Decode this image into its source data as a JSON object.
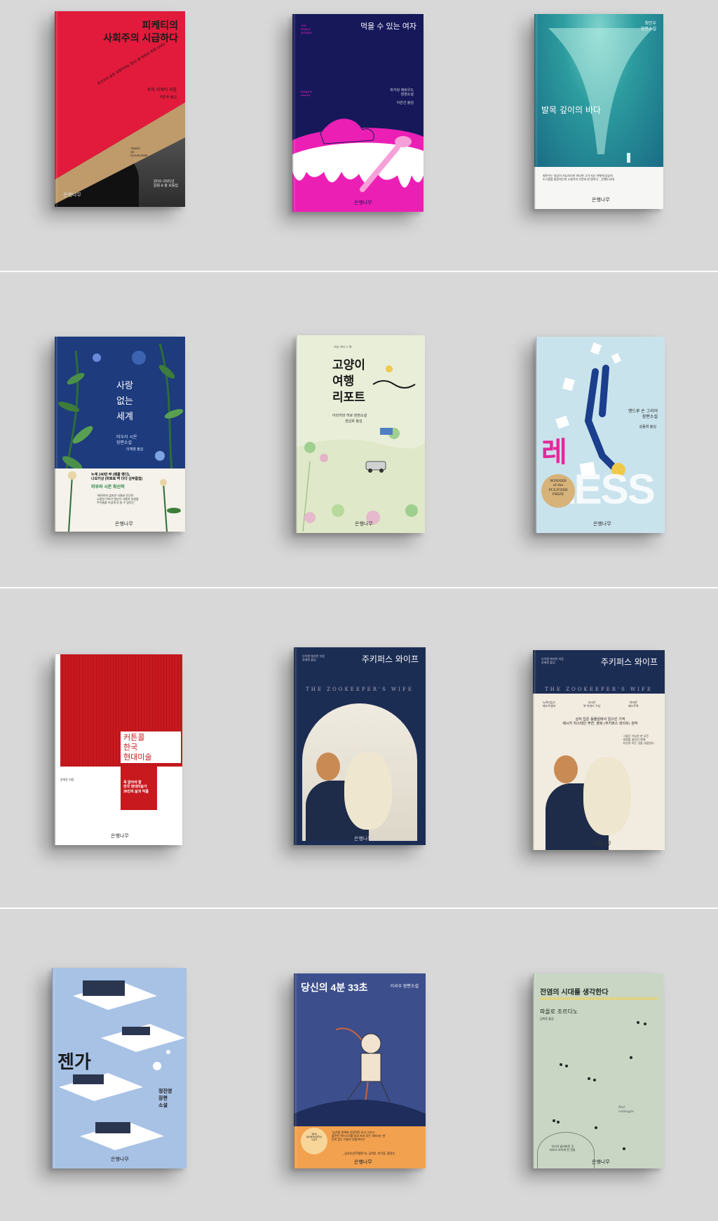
{
  "books": [
    {
      "title": "피케티의\n사회주의 시급하다",
      "tagline": "공산주의 같은 치명적이는 한다! 총 부자의 독재 시대다",
      "author": "토마 피케티 지음",
      "translator": "이민주 옮김",
      "english_title": "TEMPS\nDE\nSOCIALISME",
      "year_note": "2016~2021년\n칼럼 & 총 모음집",
      "publisher": "은행나무",
      "colors": {
        "top": "#e21b3c",
        "band": "#bf9a6a",
        "text": "#1a1a1a"
      }
    },
    {
      "title": "먹을 수 있는 여자",
      "english_title": "THE\nEDIBLE\nWOMAN",
      "english_author": "Margaret\nAtwood",
      "author": "마거릿 애트우드\n장편소설",
      "translator": "이은선 옮김",
      "publisher": "은행나무",
      "colors": {
        "bg": "#16185a",
        "accent": "#ec1fb5"
      }
    },
    {
      "author": "최민우\n장편소설",
      "title": "발목 깊이의 바다",
      "blurb": "최민우는 일상이 가능하기만 하다면 그가 지닌 어떻게 상상의\n도시풍을 발랑하는데 소설가의 가운데 한 명이다. _은행도서대",
      "publisher": "은행나무",
      "colors": {
        "sea": "#2c9c9f",
        "deep": "#1a6c85"
      }
    },
    {
      "title": "사랑\n없는\n세계",
      "author": "미우라 시온\n장편소설",
      "translator": "이재영 옮김",
      "headline": "누계 140만 부 (배를 엮다),\n나오키상 (마호로 역 다다 심부름집)",
      "highlight": "미우라 시온 최신작",
      "quote": "\"화려하지 않지만 식물과 인간이\n소중한 이야기 빛난다 식물의 일생을\n주어들을 뜨겁게 뒤 일 수 있다는\"",
      "publisher": "은행나무",
      "colors": {
        "bg": "#1d3b7d",
        "plant": "#2f6c3a"
      }
    },
    {
      "series": "오늘 이미 그 책",
      "title": "고양이\n여행\n리포트",
      "author": "아리카와 히로 장편소설",
      "translator": "권남희 옮김",
      "publisher": "은행나무",
      "colors": {
        "bg": "#e9eed8",
        "ink": "#1a1a1a"
      }
    },
    {
      "author": "앤드루 숀 그리어\n장편소설",
      "translator": "강동혁 옮김",
      "title_ko": "레 스",
      "title_en": "LESS",
      "badge": "WINNER\nof the\nPULITZER\nPRIZE",
      "publisher": "은행나무",
      "colors": {
        "bg": "#c9e3ed",
        "title": "#e3299a",
        "badge": "#d7b37a"
      }
    },
    {
      "title": "커튼콜\n한국\n현대미술",
      "author": "양세윤 지음",
      "tagline": "꼭 알아야 할\n한국 현대미술가\n36인의 삶과 작품",
      "publisher": "은행나무",
      "colors": {
        "red": "#c8191f",
        "white": "#ffffff"
      }
    },
    {
      "author": "다이앤 애커먼 지음\n강혜정 옮김",
      "title": "주키퍼스 와이프",
      "english_title": "THE ZOOKEEPER'S WIFE",
      "publisher": "은행나무",
      "colors": {
        "bg": "#1c2d54",
        "arch": "#ddd7c9"
      }
    },
    {
      "author": "다이앤 애커먼 지음\n강혜정 옮김",
      "title": "주키퍼스 와이프",
      "english_title": "THE ZOOKEEPER'S WIFE",
      "awards": [
        "뉴욕타임스\n베스트셀러",
        "오리온\n북 어워드 수상",
        "아마존\n베스트북"
      ],
      "subtitle": "상처 입은 동물원에서 일으킨 기적\n제시카 차스테인 주연, 영화 (주키퍼스 와이프) 원작",
      "blurb": "그들은 가능한 한 모든\n생명을 살리기 위해\n자신의 모든 것을 내걸었다.",
      "publisher": "은행나무",
      "colors": {
        "bg": "#1c2d54",
        "cream": "#f2ece0"
      }
    },
    {
      "title": "젠가",
      "author": "정진영\n장편\n소설",
      "publisher": "은행나무",
      "colors": {
        "bg": "#a8c2e6",
        "dark": "#2a3550"
      }
    },
    {
      "title": "당신의 4분 33초",
      "author": "이서수 장편소설",
      "quote": "\"늦은밤 관계와 안정적인 요식 그리고\n잠깐된 섹스스므를 동네 자리 모든 세하라는 한\n준비 있는 이들로 만을어뜨는\"",
      "quote_source": "_임서은(문학평론가), 김희윤, 피기훈, 황정은",
      "badge": "제6회\n황산벌청년문학상\n수상작",
      "publisher": "은행나무",
      "colors": {
        "bg": "#3c4e8c",
        "orange": "#f2a14f"
      }
    },
    {
      "title": "전염의 시대를 생각한다",
      "author": "파올로 조르다노",
      "translator": "김희정 옮김",
      "english_title": "Nel\ncontagio",
      "footer": "우리가 잃어버린 것\n비로소 보이게 된 것들",
      "publisher": "은행나무",
      "colors": {
        "bg": "#c9d6c4",
        "ink": "#1f2a22"
      }
    }
  ]
}
